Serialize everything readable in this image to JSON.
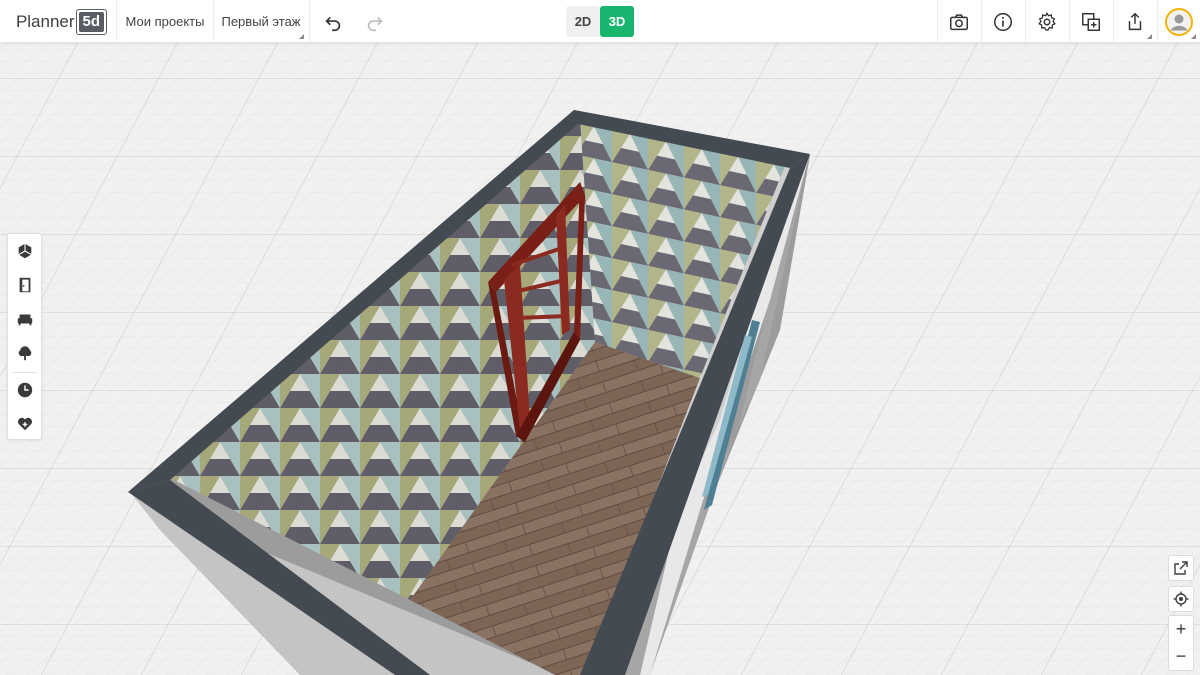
{
  "app": {
    "logo_text": "Planner",
    "logo_badge": "5d",
    "brand_green": "#18b56f"
  },
  "topbar": {
    "projects_label": "Мои проекты",
    "floor_label": "Первый этаж",
    "undo_icon": "undo-icon",
    "redo_icon": "redo-icon",
    "view_2d_label": "2D",
    "view_3d_label": "3D",
    "active_view": "3D",
    "right_icons": [
      "camera-icon",
      "info-icon",
      "settings-icon",
      "add-copy-icon",
      "share-icon",
      "user-avatar"
    ]
  },
  "left_tools": [
    {
      "name": "construction-tool",
      "icon": "box-3d-icon"
    },
    {
      "name": "doors-windows-tool",
      "icon": "door-icon"
    },
    {
      "name": "furniture-tool",
      "icon": "sofa-icon"
    },
    {
      "name": "exterior-tool",
      "icon": "tree-icon"
    },
    {
      "name": "history-tool",
      "icon": "clock-icon"
    },
    {
      "name": "favorites-tool",
      "icon": "heart-plus-icon"
    }
  ],
  "view_controls": {
    "open_external_icon": "external-link-icon",
    "locate_icon": "locate-icon",
    "zoom_in_label": "+",
    "zoom_out_label": "−"
  }
}
